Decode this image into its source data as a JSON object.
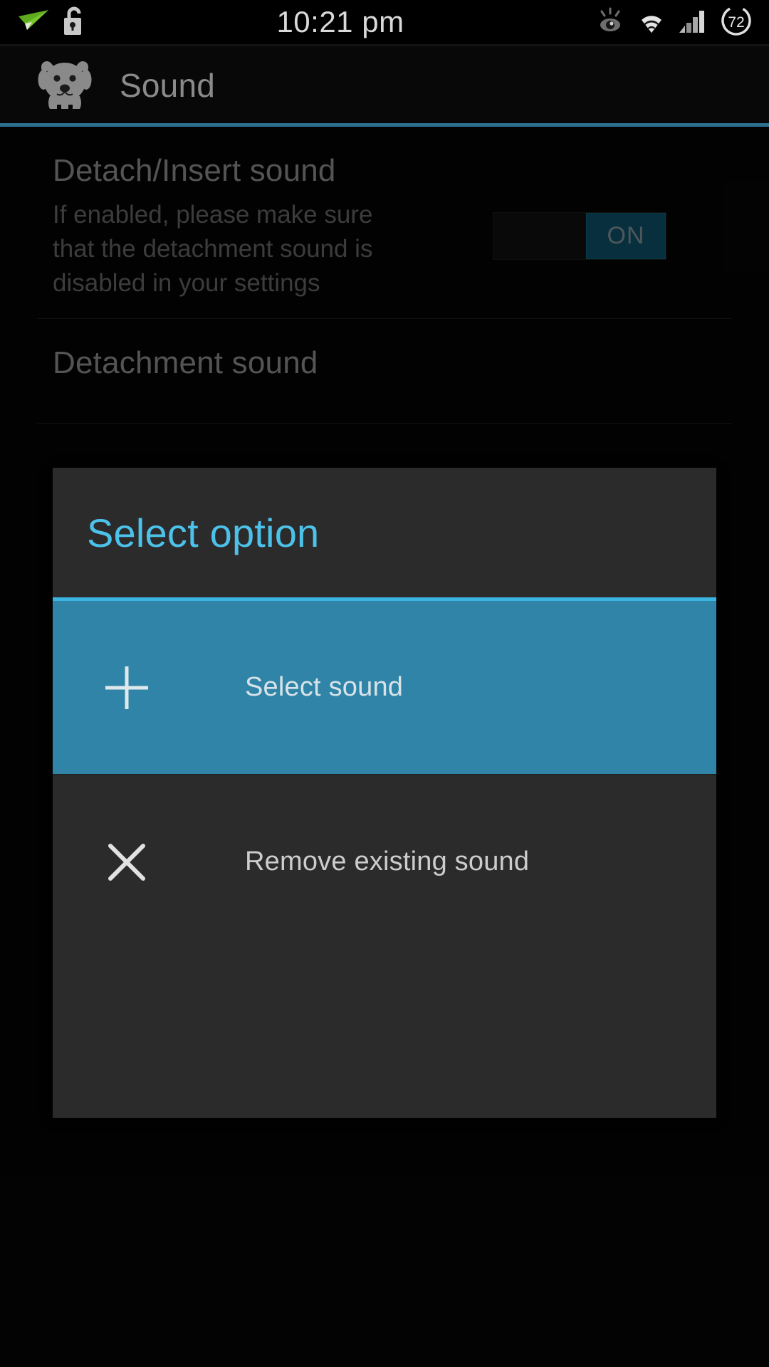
{
  "statusbar": {
    "clock": "10:21 pm",
    "left_icons": [
      {
        "name": "paper-plane-icon",
        "label": "paper-plane"
      },
      {
        "name": "unlock-icon",
        "label": "unlocked-padlock"
      }
    ],
    "right_icons": [
      {
        "name": "smart-stay-eye-icon",
        "label": "smart-stay-eye"
      },
      {
        "name": "wifi-icon",
        "label": "wifi-full"
      },
      {
        "name": "cellular-signal-icon",
        "label": "signal-bars"
      }
    ],
    "battery": {
      "name": "battery-icon",
      "percent": "72"
    }
  },
  "actionbar": {
    "app_icon": "dog-icon",
    "title": "Sound"
  },
  "preferences": [
    {
      "title": "Detach/Insert sound",
      "summary": "If enabled, please make sure that the detachment sound is disabled in your settings",
      "switch": {
        "state": "ON",
        "checked": true
      }
    },
    {
      "title": "Detachment sound",
      "summary": ""
    }
  ],
  "dialog": {
    "title": "Select option",
    "items": [
      {
        "icon": "plus-icon",
        "label": "Select sound",
        "selected": true
      },
      {
        "icon": "close-x-icon",
        "label": "Remove existing sound",
        "selected": false
      }
    ]
  },
  "colors": {
    "accent_bar": "#2d6f8e",
    "dialog_title": "#4cc2ea",
    "dialog_rule": "#3ab4e0",
    "selected_row": "#2f84a7",
    "switch_on": "#0d5770",
    "background": "#050505",
    "dialog_bg": "#2b2b2b"
  }
}
